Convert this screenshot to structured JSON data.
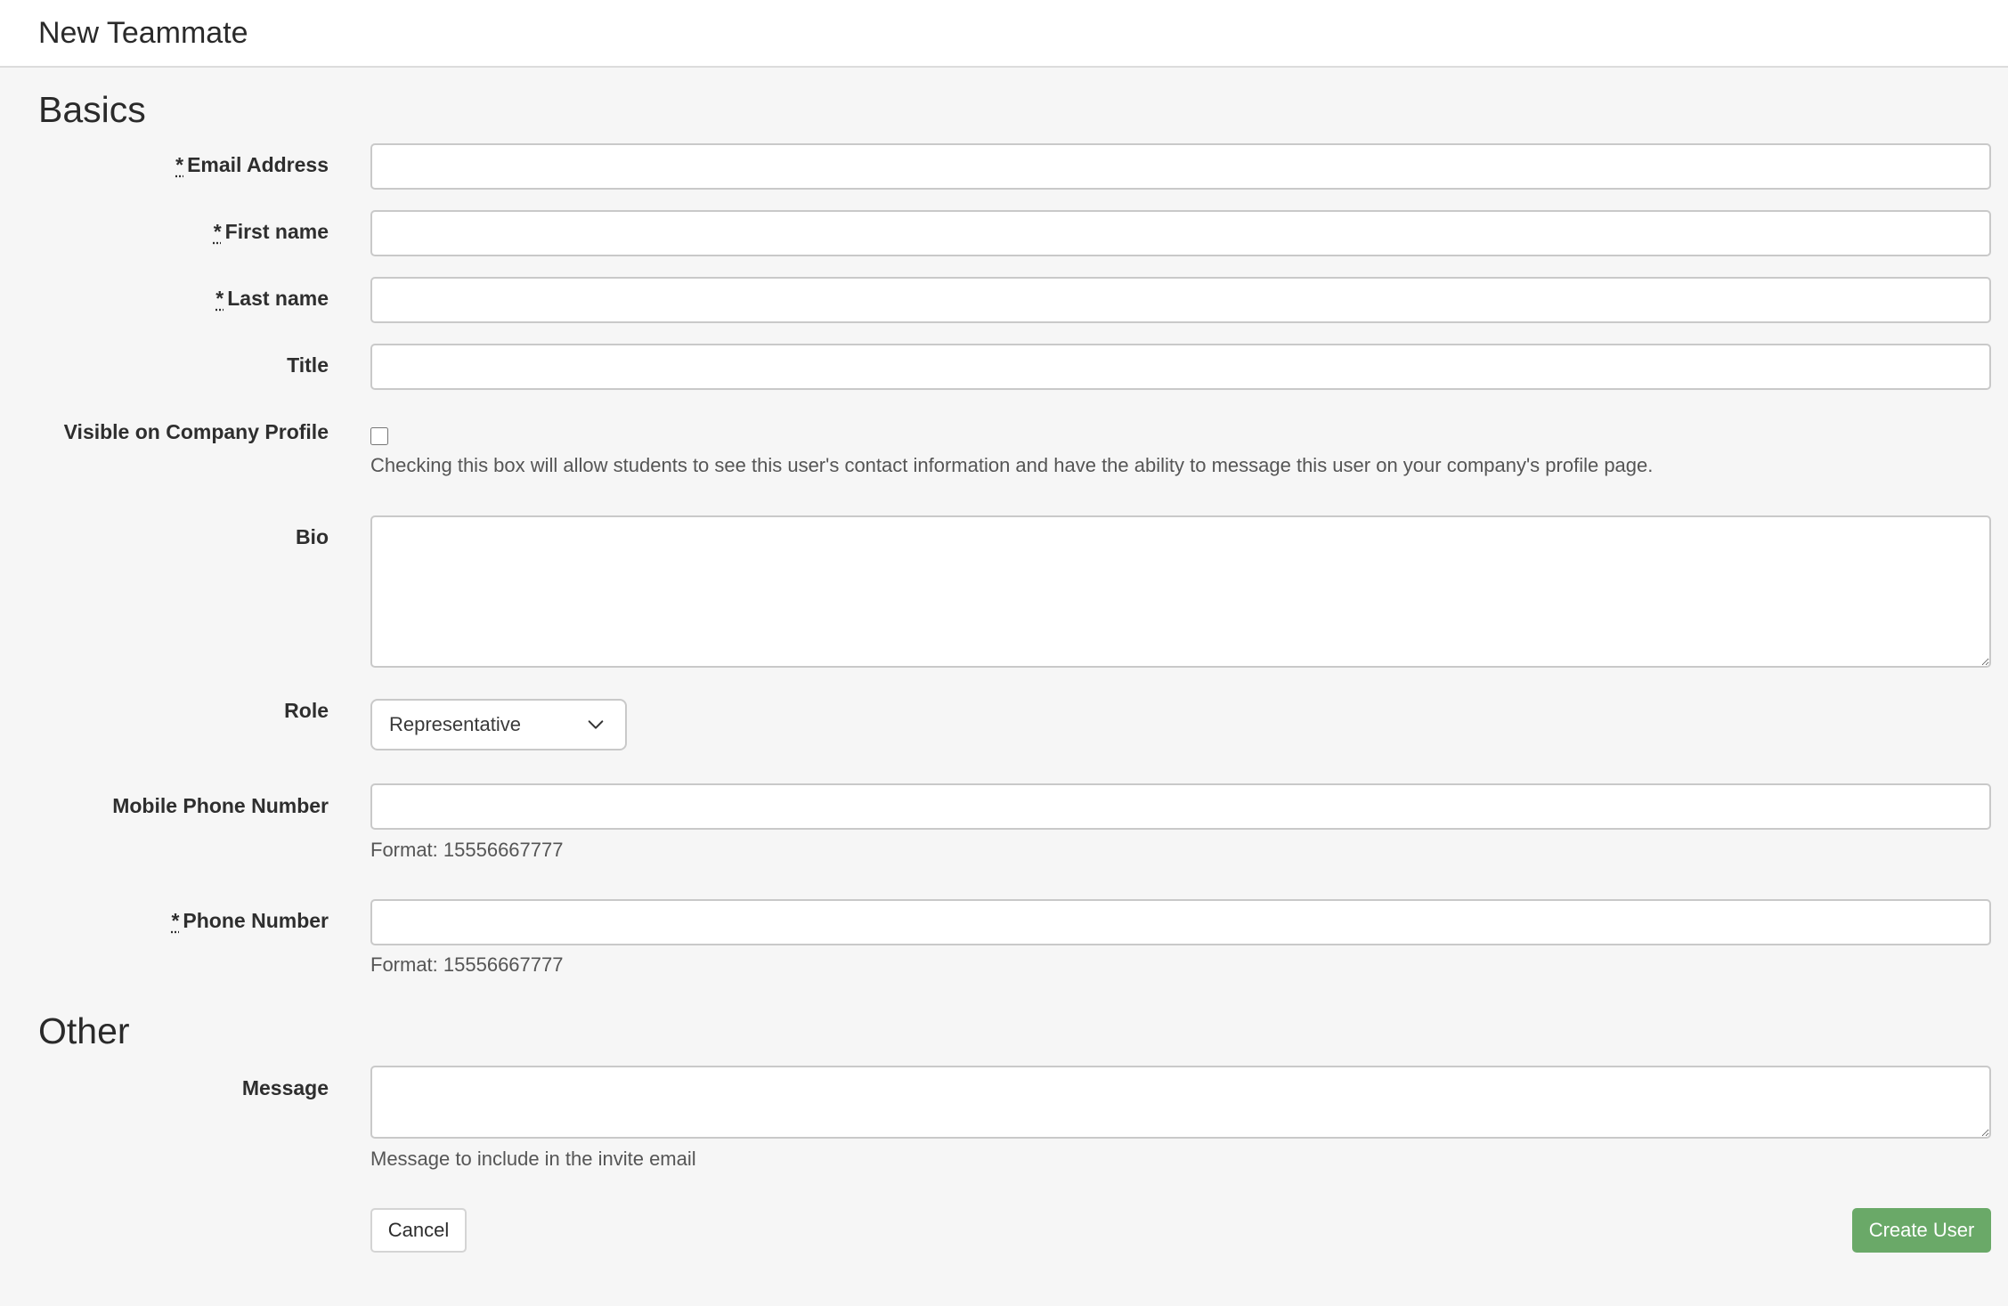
{
  "header": {
    "title": "New Teammate"
  },
  "sections": {
    "basics": "Basics",
    "other": "Other"
  },
  "required_marker": "*",
  "fields": {
    "email": {
      "label": "Email Address",
      "value": ""
    },
    "first_name": {
      "label": "First name",
      "value": ""
    },
    "last_name": {
      "label": "Last name",
      "value": ""
    },
    "title": {
      "label": "Title",
      "value": ""
    },
    "visible_on_profile": {
      "label": "Visible on Company Profile",
      "checked": false,
      "help": "Checking this box will allow students to see this user's contact information and have the ability to message this user on your company's profile page."
    },
    "bio": {
      "label": "Bio",
      "value": ""
    },
    "role": {
      "label": "Role",
      "selected": "Representative"
    },
    "mobile_phone": {
      "label": "Mobile Phone Number",
      "value": "",
      "help": "Format: 15556667777"
    },
    "phone": {
      "label": "Phone Number",
      "value": "",
      "help": "Format: 15556667777"
    },
    "message": {
      "label": "Message",
      "value": "",
      "help": "Message to include in the invite email"
    }
  },
  "buttons": {
    "cancel": "Cancel",
    "submit": "Create User"
  },
  "colors": {
    "primary_button": "#6aa968",
    "background": "#f6f6f6"
  },
  "icons": {
    "role_dropdown": "chevron-down-icon"
  }
}
